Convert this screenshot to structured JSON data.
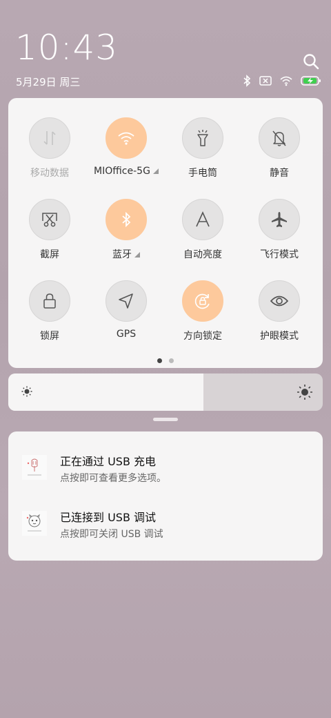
{
  "status": {
    "time": "10:43",
    "date": "5月29日 周三",
    "icons": [
      "bluetooth-icon",
      "sim-off-icon",
      "wifi-icon",
      "battery-charging-icon"
    ]
  },
  "quick_settings": {
    "tiles": [
      {
        "label": "移动数据",
        "icon": "mobile-data-icon",
        "state": "disabled"
      },
      {
        "label": "MIOffice-5G",
        "icon": "wifi-icon",
        "state": "on",
        "expandable": true
      },
      {
        "label": "手电筒",
        "icon": "flashlight-icon",
        "state": "off"
      },
      {
        "label": "静音",
        "icon": "mute-bell-icon",
        "state": "off"
      },
      {
        "label": "截屏",
        "icon": "screenshot-icon",
        "state": "off"
      },
      {
        "label": "蓝牙",
        "icon": "bluetooth-icon",
        "state": "on",
        "expandable": true
      },
      {
        "label": "自动亮度",
        "icon": "auto-brightness-icon",
        "state": "off"
      },
      {
        "label": "飞行模式",
        "icon": "airplane-icon",
        "state": "off"
      },
      {
        "label": "锁屏",
        "icon": "lock-icon",
        "state": "off"
      },
      {
        "label": "GPS",
        "icon": "location-arrow-icon",
        "state": "off"
      },
      {
        "label": "方向锁定",
        "icon": "rotation-lock-icon",
        "state": "on"
      },
      {
        "label": "护眼模式",
        "icon": "eye-icon",
        "state": "off"
      }
    ],
    "page_count": 2,
    "current_page": 1
  },
  "brightness": {
    "level": 0.62
  },
  "notifications": [
    {
      "title": "正在通过 USB 充电",
      "body": "点按即可查看更多选项。",
      "icon": "usb-app-icon"
    },
    {
      "title": "已连接到 USB 调试",
      "body": "点按即可关闭 USB 调试",
      "icon": "usb-debug-app-icon"
    }
  ],
  "colors": {
    "accent_on": "#fdc99c",
    "tile_off": "#e4e3e3",
    "panel": "#f6f5f5"
  }
}
